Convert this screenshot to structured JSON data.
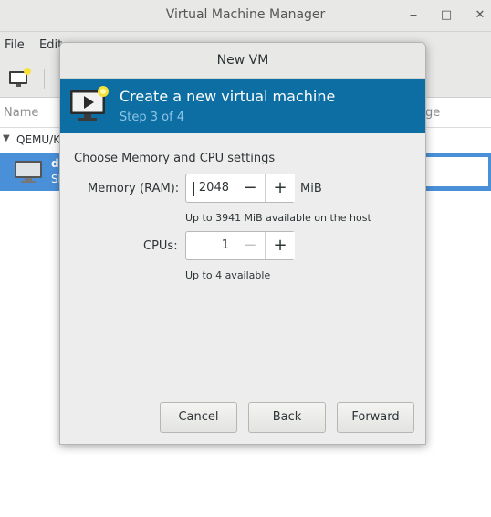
{
  "main_window": {
    "title": "Virtual Machine Manager",
    "controls": {
      "minimize": "‒",
      "maximize": "□",
      "close": "✕"
    },
    "menu": {
      "file": "File",
      "edit": "Edit"
    },
    "list_headers": {
      "name": "Name",
      "usage": "ge"
    },
    "connection_group": "QEMU/K",
    "vm_row": {
      "name": "de",
      "state": "Sh"
    }
  },
  "dialog": {
    "title": "New VM",
    "banner": {
      "title": "Create a new virtual machine",
      "step": "Step 3 of 4"
    },
    "section_title": "Choose Memory and CPU settings",
    "memory": {
      "label": "Memory (RAM):",
      "value": "2048",
      "unit": "MiB",
      "hint": "Up to 3941 MiB available on the host",
      "decrement": "−",
      "increment": "+"
    },
    "cpus": {
      "label": "CPUs:",
      "value": "1",
      "hint": "Up to 4 available",
      "decrement": "−",
      "increment": "+"
    },
    "buttons": {
      "cancel": "Cancel",
      "back": "Back",
      "forward": "Forward"
    }
  },
  "colors": {
    "banner_bg": "#0d6ea3",
    "banner_step": "#8fc4e6",
    "selection": "#4a90d9"
  },
  "icons": {
    "new_vm": "new-vm-icon",
    "banner": "vm-install-icon",
    "vm_monitor": "monitor-icon"
  }
}
